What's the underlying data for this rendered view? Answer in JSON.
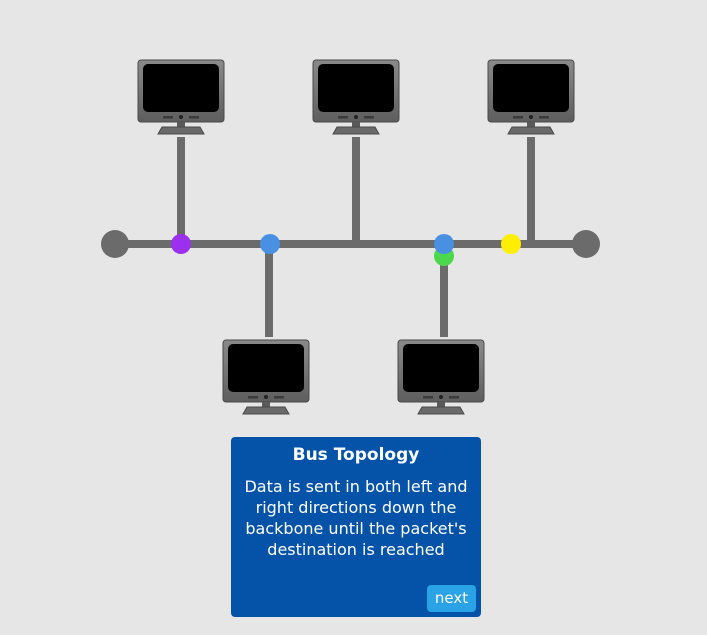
{
  "card": {
    "title": "Bus Topology",
    "body": "Data is sent in both left and right directions down the backbone until the packet's destination is reached",
    "next_label": "next"
  },
  "colors": {
    "background": "#e6e6e6",
    "cable": "#6b6b6b",
    "card": "#0553a8",
    "next_button": "#29a3e6",
    "packet_purple": "#9b30f0",
    "packet_blue": "#4a90e2",
    "packet_green": "#4cd84c",
    "packet_yellow": "#ffee00"
  },
  "diagram": {
    "topology": "bus",
    "computers": [
      "computer-top-left",
      "computer-top-center",
      "computer-top-right",
      "computer-bottom-left",
      "computer-bottom-right"
    ],
    "packets": [
      {
        "id": "packet-purple",
        "color": "purple"
      },
      {
        "id": "packet-blue-left",
        "color": "blue"
      },
      {
        "id": "packet-blue-right",
        "color": "blue"
      },
      {
        "id": "packet-green",
        "color": "green"
      },
      {
        "id": "packet-yellow",
        "color": "yellow"
      }
    ]
  }
}
